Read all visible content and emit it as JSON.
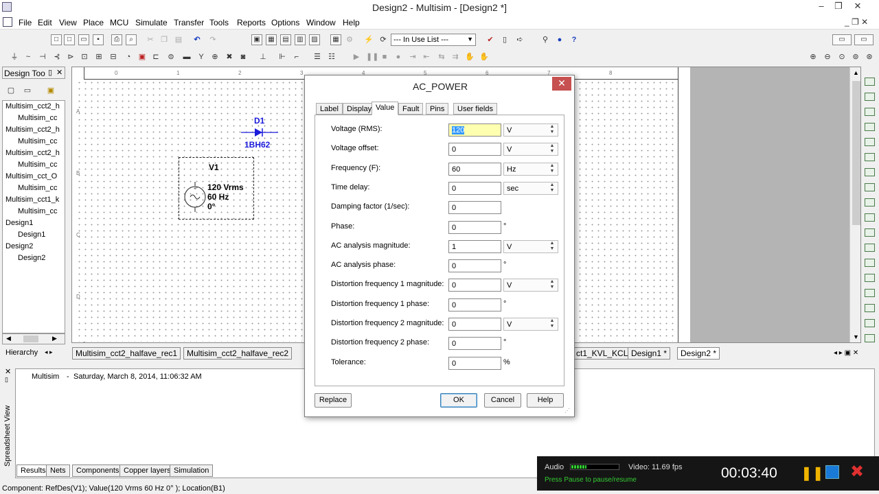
{
  "window": {
    "title": "Design2 - Multisim - [Design2 *]",
    "min": "–",
    "max": "❐",
    "close": "✕"
  },
  "menu": [
    "File",
    "Edit",
    "View",
    "Place",
    "MCU",
    "Simulate",
    "Transfer",
    "Tools",
    "Reports",
    "Options",
    "Window",
    "Help"
  ],
  "toolbar": {
    "in_use_list": "--- In Use List ---"
  },
  "design_toolbox": {
    "title": "Design Too",
    "items": [
      "Multisim_cct2_h",
      "Multisim_cc",
      "Multisim_cct2_h",
      "Multisim_cc",
      "Multisim_cct2_h",
      "Multisim_cc",
      "Multisim_cct_O",
      "Multisim_cc",
      "Multisim_cct1_k",
      "Multisim_cc",
      "Design1",
      "Design1",
      "Design2",
      "Design2"
    ],
    "hierarchy_tab": "Hierarchy"
  },
  "schematic": {
    "diode_ref": "D1",
    "diode_model": "1BH62",
    "source_ref": "V1",
    "source_lines": [
      "120 Vrms",
      "60 Hz",
      "0°"
    ],
    "border_rows": [
      "A",
      "B",
      "C",
      "D"
    ],
    "border_cols": [
      "0",
      "1",
      "2",
      "3",
      "4",
      "5",
      "6",
      "7",
      "8"
    ]
  },
  "doc_tabs": [
    "Multisim_cct2_halfave_rec1",
    "Multisim_cct2_halfave_rec2",
    "ct1_KVL_KCL *",
    "Design1 *",
    "Design2 *"
  ],
  "bottom_panel": {
    "side_label": "Spreadsheet View",
    "log_source": "Multisim",
    "log_sep": "-",
    "log_text": "Saturday, March 8, 2014, 11:06:32 AM",
    "tabs": [
      "Results",
      "Nets",
      "Components",
      "Copper layers",
      "Simulation"
    ]
  },
  "status": {
    "text": "Component: RefDes(V1); Value(120 Vrms  60 Hz  0° ); Location(B1)"
  },
  "dialog": {
    "title": "AC_POWER",
    "tabs": [
      "Label",
      "Display",
      "Value",
      "Fault",
      "Pins",
      "User fields"
    ],
    "active_tab": "Value",
    "params": [
      {
        "label": "Voltage (RMS):",
        "value": "120",
        "unit": "V",
        "spin": true
      },
      {
        "label": "Voltage offset:",
        "value": "0",
        "unit": "V",
        "spin": true
      },
      {
        "label": "Frequency (F):",
        "value": "60",
        "unit": "Hz",
        "spin": true
      },
      {
        "label": "Time delay:",
        "value": "0",
        "unit": "sec",
        "spin": true
      },
      {
        "label": "Damping factor (1/sec):",
        "value": "0",
        "unit": "",
        "spin": false
      },
      {
        "label": "Phase:",
        "value": "0",
        "unit": "°",
        "spin": false
      },
      {
        "label": "AC analysis magnitude:",
        "value": "1",
        "unit": "V",
        "spin": true
      },
      {
        "label": "AC analysis phase:",
        "value": "0",
        "unit": "°",
        "spin": false
      },
      {
        "label": "Distortion frequency 1 magnitude:",
        "value": "0",
        "unit": "V",
        "spin": true
      },
      {
        "label": "Distortion frequency 1 phase:",
        "value": "0",
        "unit": "°",
        "spin": false
      },
      {
        "label": "Distortion frequency 2 magnitude:",
        "value": "0",
        "unit": "V",
        "spin": true
      },
      {
        "label": "Distortion frequency 2 phase:",
        "value": "0",
        "unit": "°",
        "spin": false
      },
      {
        "label": "Tolerance:",
        "value": "0",
        "unit": "%",
        "spin": false
      }
    ],
    "buttons": {
      "replace": "Replace",
      "ok": "OK",
      "cancel": "Cancel",
      "help": "Help"
    }
  },
  "recorder": {
    "audio_label": "Audio",
    "video_label": "Video: 11.69 fps",
    "hint": "Press Pause to pause/resume",
    "time": "00:03:40"
  },
  "colors": {
    "accent": "#1a1adc",
    "close_red": "#c75050",
    "selection": "#3399ff"
  }
}
